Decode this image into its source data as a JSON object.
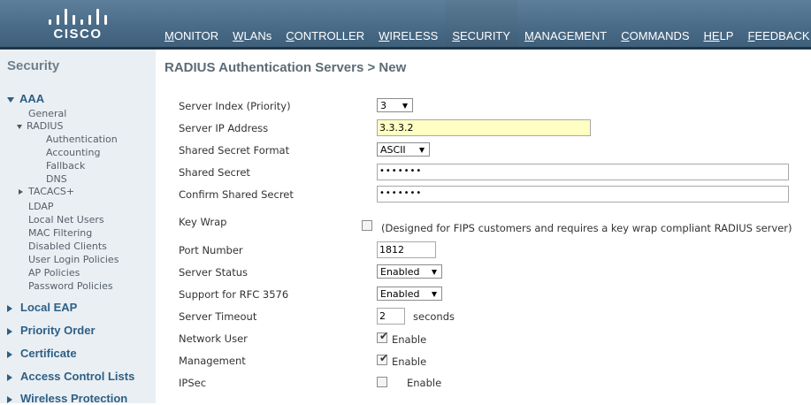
{
  "brand": {
    "logo_text": "CISCO"
  },
  "nav": [
    {
      "label": "MONITOR",
      "u": "M",
      "rest": "ONITOR"
    },
    {
      "label": "WLANs",
      "u": "W",
      "rest": "LANs"
    },
    {
      "label": "CONTROLLER",
      "u": "C",
      "rest": "ONTROLLER"
    },
    {
      "label": "WIRELESS",
      "u": "W",
      "rest": "IRELESS"
    },
    {
      "label": "SECURITY",
      "u": "S",
      "rest": "ECURITY"
    },
    {
      "label": "MANAGEMENT",
      "u": "M",
      "rest": "ANAGEMENT"
    },
    {
      "label": "COMMANDS",
      "u": "C",
      "rest": "OMMANDS"
    },
    {
      "label": "HELP",
      "u": "HE",
      "rest": "LP"
    },
    {
      "label": "FEEDBACK",
      "u": "F",
      "rest": "EEDBACK"
    }
  ],
  "sidebar": {
    "title": "Security",
    "aaa": "AAA",
    "general": "General",
    "radius": "RADIUS",
    "authentication": "Authentication",
    "accounting": "Accounting",
    "fallback": "Fallback",
    "dns": "DNS",
    "tacacs": "TACACS+",
    "ldap": "LDAP",
    "local_net_users": "Local Net Users",
    "mac_filtering": "MAC Filtering",
    "disabled_clients": "Disabled Clients",
    "user_login_policies": "User Login Policies",
    "ap_policies": "AP Policies",
    "password_policies": "Password Policies",
    "local_eap": "Local EAP",
    "priority_order": "Priority Order",
    "certificate": "Certificate",
    "access_control_lists": "Access Control Lists",
    "wireless_protection": "Wireless Protection"
  },
  "main": {
    "title": "RADIUS Authentication Servers > New",
    "server_index_label": "Server Index (Priority)",
    "server_index_value": "3",
    "server_ip_label": "Server IP Address",
    "server_ip_value": "3.3.3.2",
    "secret_format_label": "Shared Secret Format",
    "secret_format_value": "ASCII",
    "shared_secret_label": "Shared Secret",
    "shared_secret_value": "•••••••",
    "confirm_secret_label": "Confirm Shared Secret",
    "confirm_secret_value": "•••••••",
    "key_wrap_label": "Key Wrap",
    "key_wrap_note": "(Designed for FIPS customers and requires a key wrap compliant RADIUS server)",
    "port_label": "Port Number",
    "port_value": "1812",
    "status_label": "Server Status",
    "status_value": "Enabled",
    "rfc_label": "Support for RFC 3576",
    "rfc_value": "Enabled",
    "timeout_label": "Server Timeout",
    "timeout_value": "2",
    "timeout_unit": "seconds",
    "network_user_label": "Network User",
    "management_label": "Management",
    "ipsec_label": "IPSec",
    "enable_text": "Enable"
  }
}
